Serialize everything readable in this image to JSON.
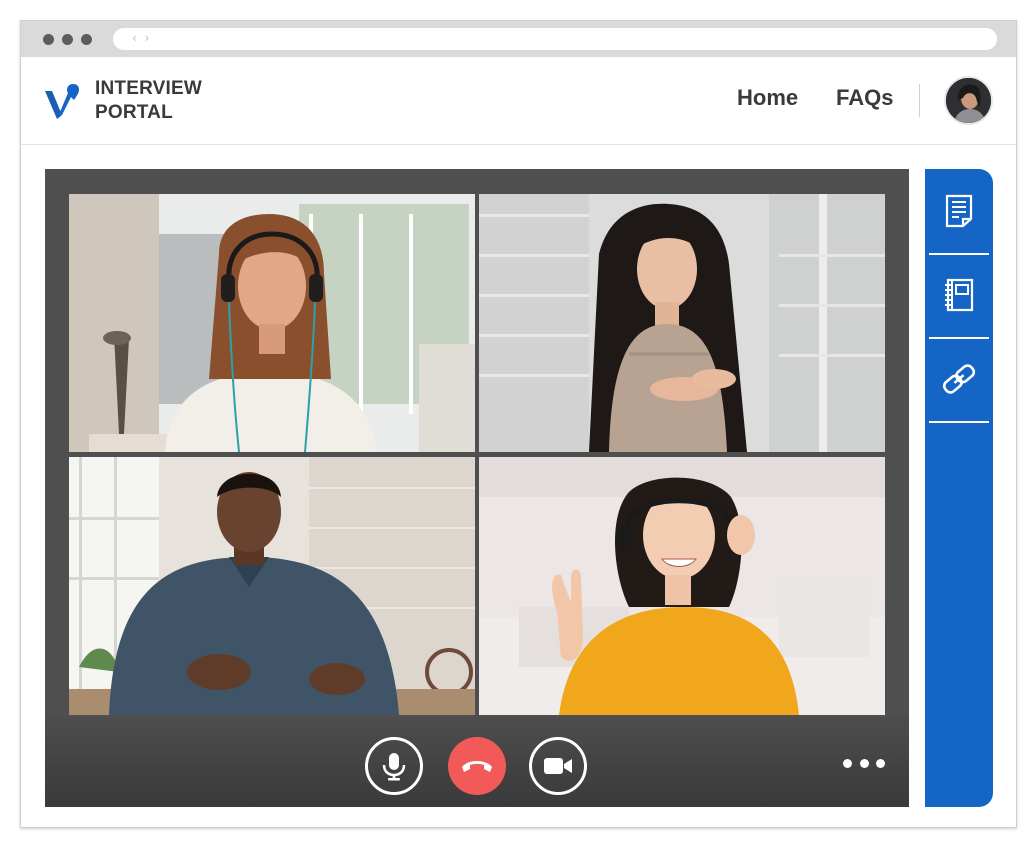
{
  "browser": {
    "nav_glyph": "‹ ›"
  },
  "header": {
    "brand_line1": "INTERVIEW",
    "brand_line2": "PORTAL",
    "nav": {
      "home": "Home",
      "faqs": "FAQs"
    },
    "avatar_icon": "user-avatar"
  },
  "video_call": {
    "participants": [
      {
        "tile": "top-left",
        "icon": "participant-video"
      },
      {
        "tile": "top-right",
        "icon": "participant-video"
      },
      {
        "tile": "bottom-left",
        "icon": "participant-video"
      },
      {
        "tile": "bottom-right",
        "icon": "participant-video"
      }
    ],
    "controls": {
      "mic_icon": "microphone-icon",
      "end_call_icon": "phone-hangup-icon",
      "camera_icon": "video-camera-icon",
      "more_icon": "more-horizontal-icon"
    }
  },
  "side_toolbar": {
    "items": [
      {
        "icon": "document-icon"
      },
      {
        "icon": "notebook-icon"
      },
      {
        "icon": "link-icon"
      }
    ]
  },
  "colors": {
    "brand_blue": "#1565c6",
    "end_call_red": "#f25a5a",
    "panel_dark": "#4f4f4f",
    "text_dark": "#3a3a3a"
  }
}
